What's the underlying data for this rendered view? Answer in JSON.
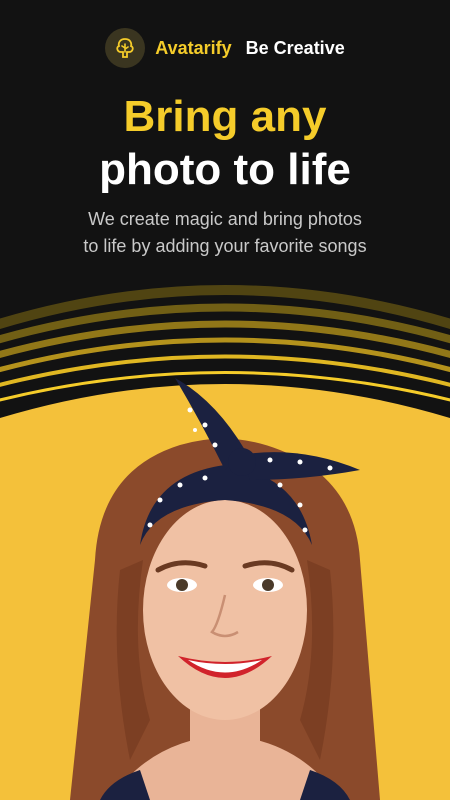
{
  "header": {
    "brand": "Avatarify",
    "tagline": "Be Creative",
    "logo_icon": "tree-icon"
  },
  "hero": {
    "headline_line1": "Bring any",
    "headline_line2": "photo to life",
    "subtitle_line1": "We create magic and bring photos",
    "subtitle_line2": "to life by adding your favorite songs"
  },
  "colors": {
    "accent": "#f5cc2a",
    "background": "#121212",
    "photo_bg": "#f4c13a",
    "text_primary": "#ffffff",
    "text_secondary": "#c9c9c9"
  }
}
